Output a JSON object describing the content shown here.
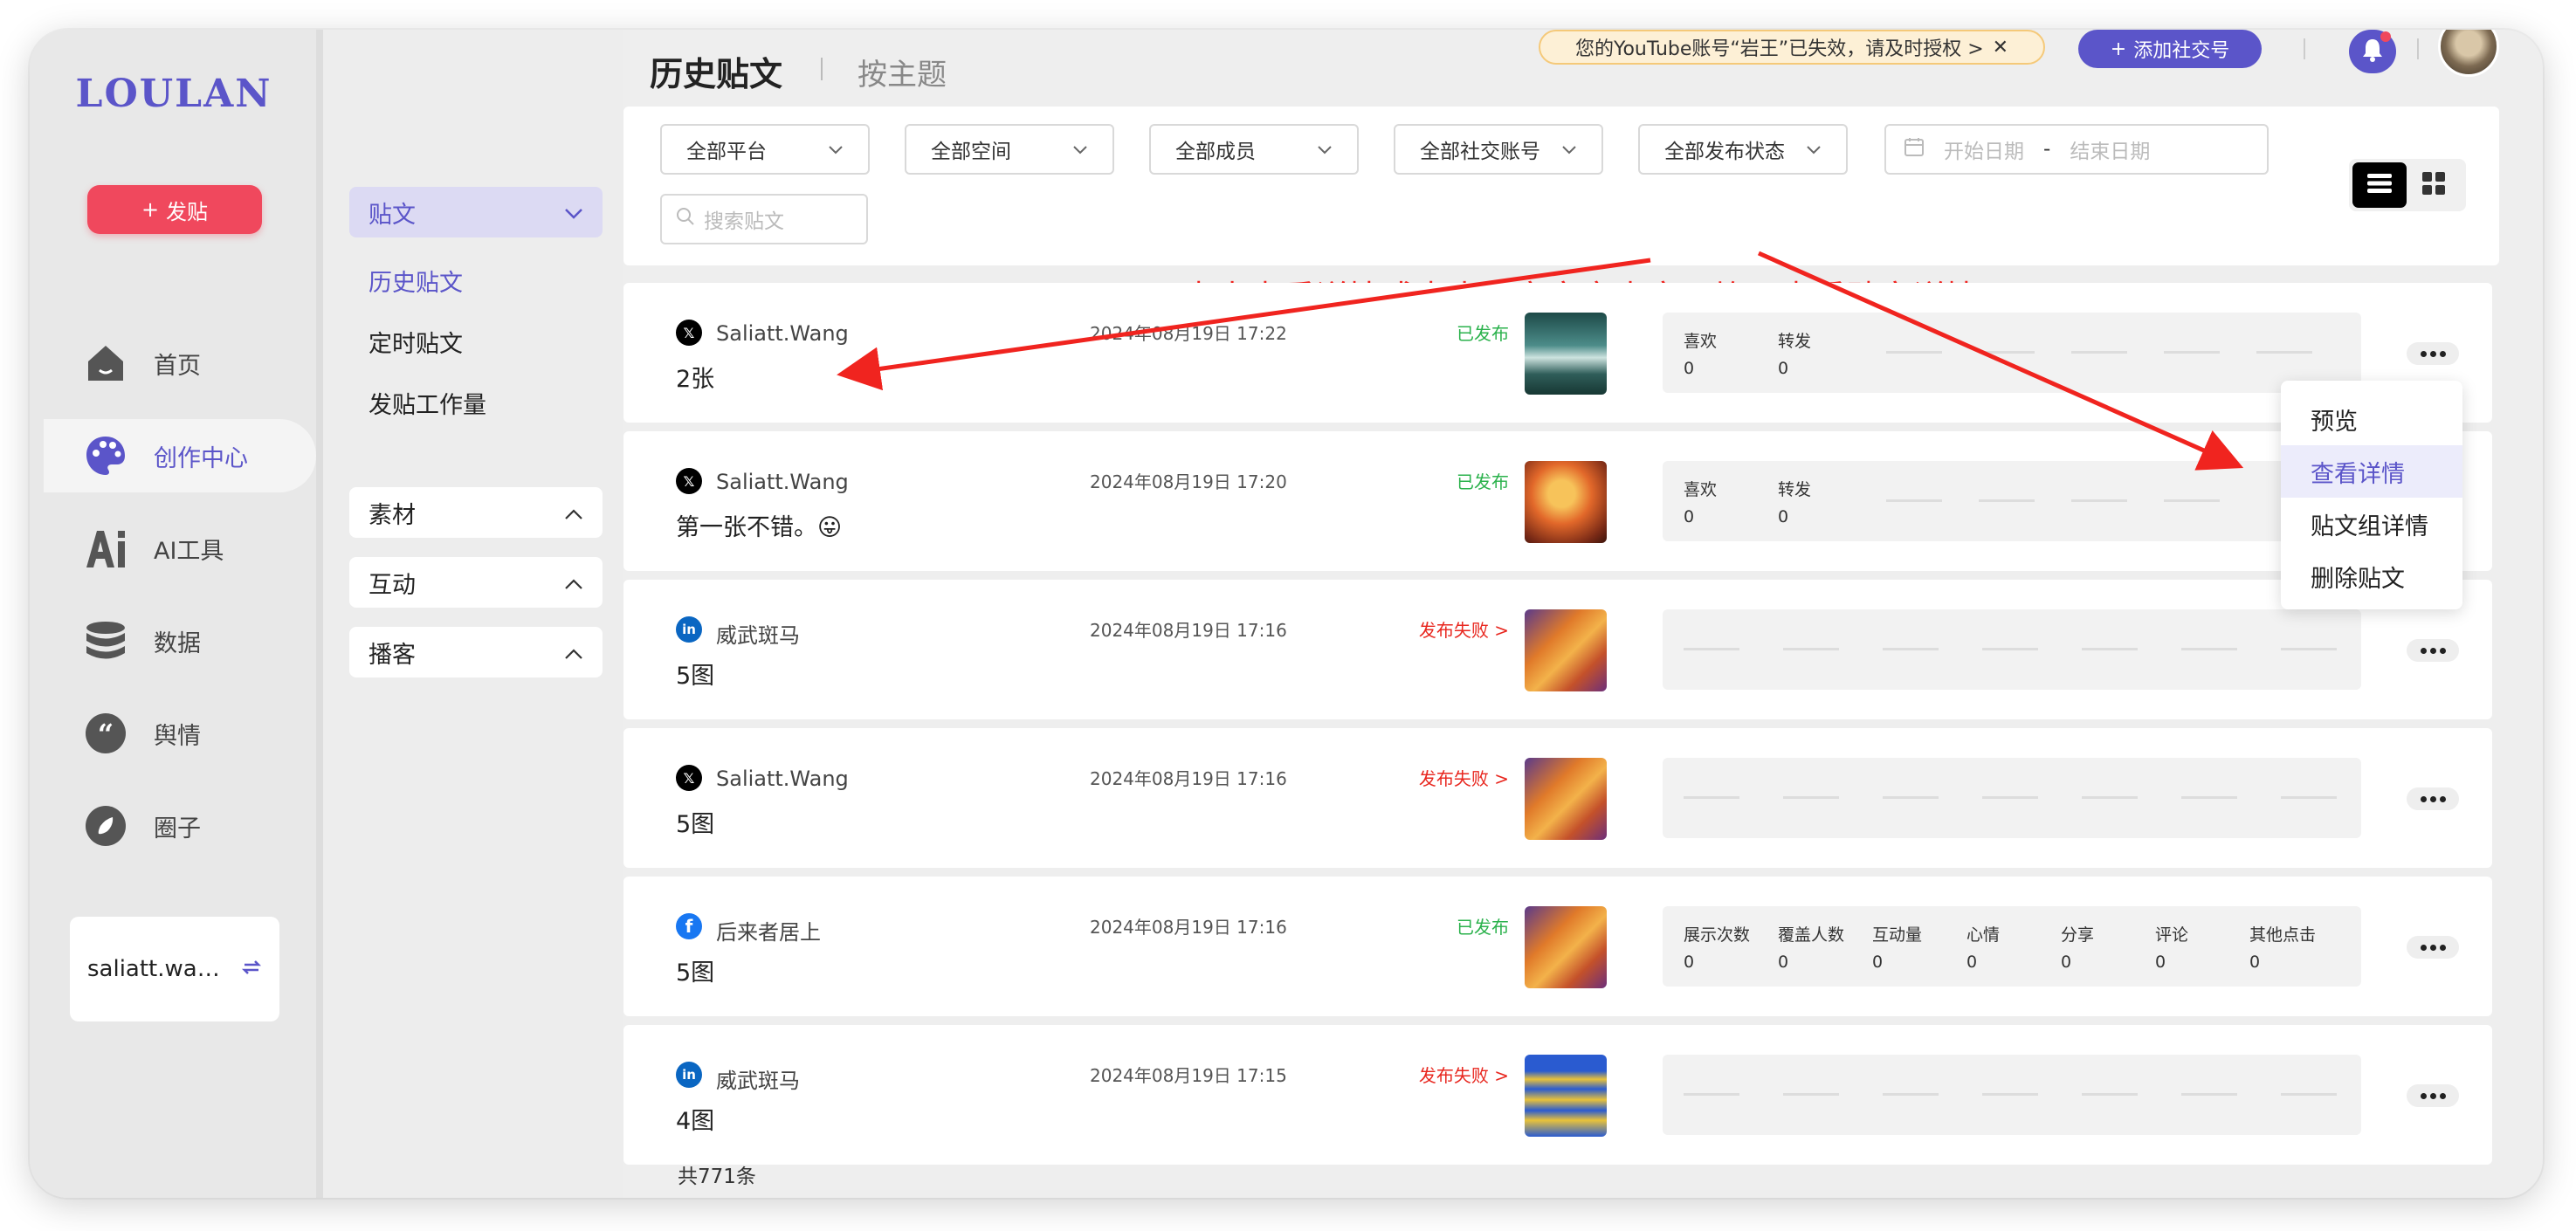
{
  "app": {
    "logo": "LOULAN"
  },
  "sidebar": {
    "post_button": "发贴",
    "nav": [
      {
        "label": "首页",
        "icon": "home-icon"
      },
      {
        "label": "创作中心",
        "icon": "palette-icon",
        "active": true
      },
      {
        "label": "AI工具",
        "icon": "ai-icon"
      },
      {
        "label": "数据",
        "icon": "database-icon"
      },
      {
        "label": "舆情",
        "icon": "quote-icon"
      },
      {
        "label": "圈子",
        "icon": "compass-icon"
      }
    ],
    "account": "saliatt.wan..."
  },
  "subnav": {
    "section": "贴文",
    "links": [
      "历史贴文",
      "定时贴文",
      "发贴工作量"
    ],
    "groups": [
      "素材",
      "互动",
      "播客"
    ]
  },
  "header": {
    "tab_active": "历史贴文",
    "tab_inactive": "按主题",
    "notice": "您的YouTube账号“岩王”已失效，请及时授权 >",
    "add_social": "添加社交号"
  },
  "filters": {
    "selects": [
      "全部平台",
      "全部空间",
      "全部成员",
      "全部社交账号",
      "全部发布状态"
    ],
    "start_date": "开始日期",
    "end_date": "结束日期",
    "date_sep": "-",
    "search_placeholder": "搜索贴文"
  },
  "annotation": "点击查看详情或点击贴文文字内容，均可查看贴文详情",
  "posts": [
    {
      "platform": "x",
      "account": "Saliatt.Wang",
      "content": "2张",
      "time": "2024年08月19日 17:22",
      "status": "已发布",
      "stats": [
        {
          "label": "喜欢",
          "value": "0"
        },
        {
          "label": "转发",
          "value": "0"
        }
      ]
    },
    {
      "platform": "x",
      "account": "Saliatt.Wang",
      "content": "第一张不错。😛",
      "time": "2024年08月19日 17:20",
      "status": "已发布",
      "stats": [
        {
          "label": "喜欢",
          "value": "0"
        },
        {
          "label": "转发",
          "value": "0"
        }
      ]
    },
    {
      "platform": "linkedin",
      "account": "威武斑马",
      "content": "5图",
      "time": "2024年08月19日 17:16",
      "status": "发布失败 >",
      "stats": []
    },
    {
      "platform": "x",
      "account": "Saliatt.Wang",
      "content": "5图",
      "time": "2024年08月19日 17:16",
      "status": "发布失败 >",
      "stats": []
    },
    {
      "platform": "facebook",
      "account": "后来者居上",
      "content": "5图",
      "time": "2024年08月19日 17:16",
      "status": "已发布",
      "stats": [
        {
          "label": "展示次数",
          "value": "0"
        },
        {
          "label": "覆盖人数",
          "value": "0"
        },
        {
          "label": "互动量",
          "value": "0"
        },
        {
          "label": "心情",
          "value": "0"
        },
        {
          "label": "分享",
          "value": "0"
        },
        {
          "label": "评论",
          "value": "0"
        },
        {
          "label": "其他点击",
          "value": "0"
        }
      ]
    },
    {
      "platform": "linkedin",
      "account": "威武斑马",
      "content": "4图",
      "time": "2024年08月19日 17:15",
      "status": "发布失败 >",
      "stats": []
    }
  ],
  "total": "共771条",
  "context_menu": [
    "预览",
    "查看详情",
    "贴文组详情",
    "删除贴文"
  ],
  "colors": {
    "accent": "#5b55c9",
    "danger": "#f0485d",
    "success": "#2bb24c",
    "fail": "#e8261e"
  }
}
